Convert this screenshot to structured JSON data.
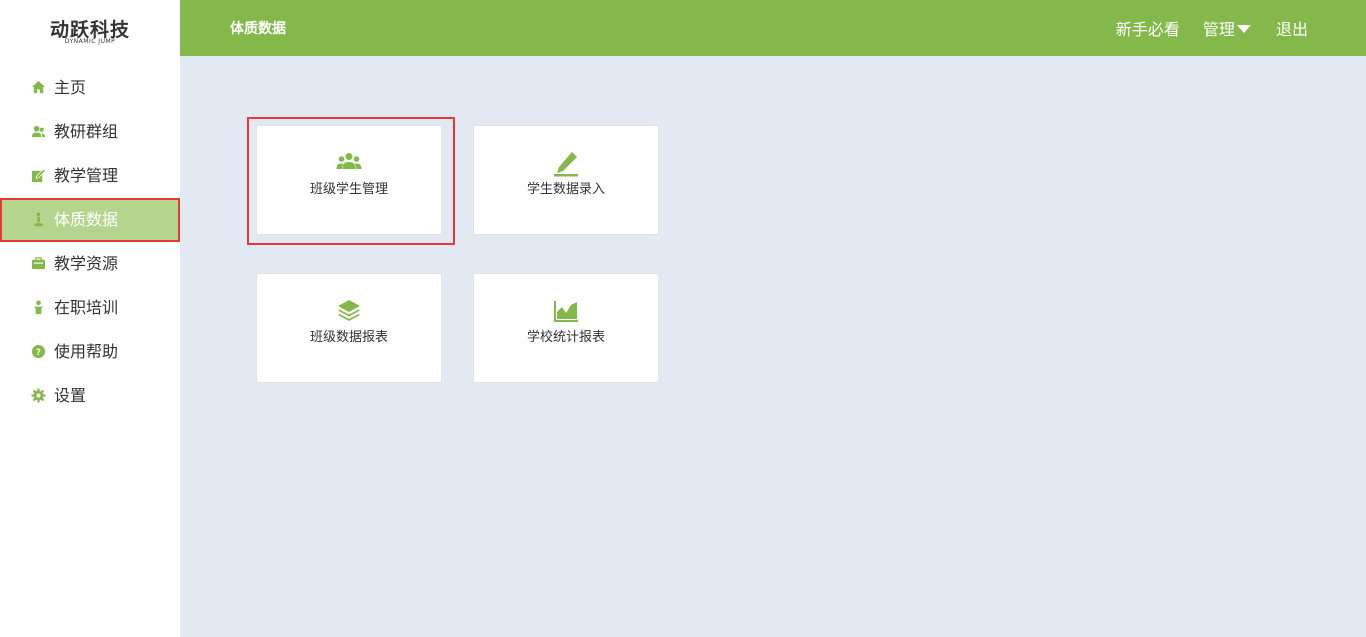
{
  "logo": {
    "title": "动跃科技",
    "subtitle": "DYNAMIC JUMP"
  },
  "sidebar": {
    "items": [
      {
        "label": "主页",
        "icon": "home-icon"
      },
      {
        "label": "教研群组",
        "icon": "users-icon"
      },
      {
        "label": "教学管理",
        "icon": "edit-icon"
      },
      {
        "label": "体质数据",
        "icon": "runner-icon",
        "active": true
      },
      {
        "label": "教学资源",
        "icon": "briefcase-icon"
      },
      {
        "label": "在职培训",
        "icon": "person-icon"
      },
      {
        "label": "使用帮助",
        "icon": "help-icon"
      },
      {
        "label": "设置",
        "icon": "gear-icon"
      }
    ]
  },
  "header": {
    "title": "体质数据",
    "links": {
      "guide": "新手必看",
      "manage": "管理",
      "logout": "退出"
    }
  },
  "cards": [
    {
      "label": "班级学生管理",
      "icon": "group-icon"
    },
    {
      "label": "学生数据录入",
      "icon": "pencil-icon"
    },
    {
      "label": "班级数据报表",
      "icon": "layers-icon"
    },
    {
      "label": "学校统计报表",
      "icon": "area-chart-icon"
    }
  ],
  "colors": {
    "brand_green": "#84b84a",
    "active_nav": "#b5d58e",
    "highlight_red": "#e53935",
    "content_bg": "#e2e9f2"
  }
}
